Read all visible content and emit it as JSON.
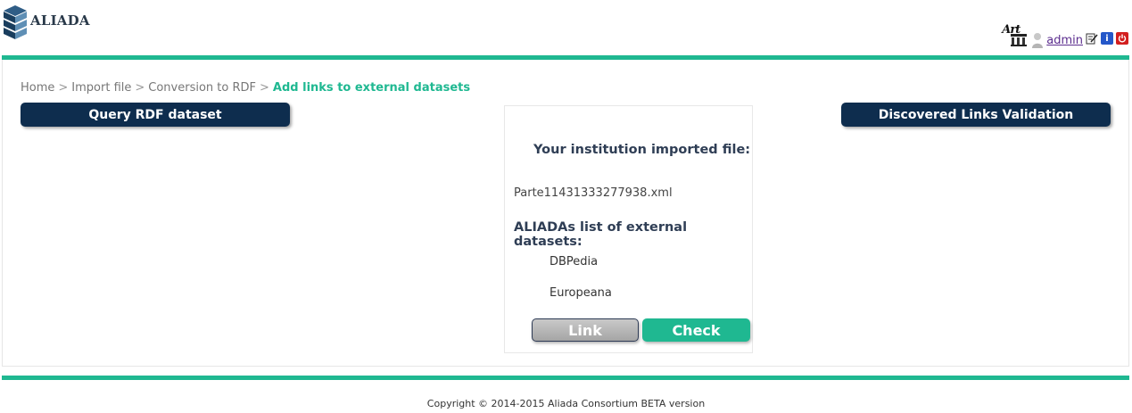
{
  "header": {
    "logo_text": "ALIADA",
    "art_icon_text": "Art",
    "username": "admin",
    "icons": [
      "art-museum-icon",
      "user-icon",
      "edit-icon",
      "info-icon",
      "power-icon"
    ]
  },
  "breadcrumb": {
    "items": [
      "Home",
      "Import file",
      "Conversion to RDF"
    ],
    "current": "Add links to external datasets"
  },
  "nav": {
    "query_label": "Query RDF dataset",
    "discovered_label": "Discovered Links Validation"
  },
  "panel": {
    "title": "Your institution imported file:",
    "filename": "Parte11431333277938.xml",
    "datasets_title": "ALIADAs list of external datasets:",
    "datasets": [
      "DBPedia",
      "Europeana"
    ],
    "link_label": "Link",
    "check_label": "Check"
  },
  "footer": {
    "text": "Copyright © 2014-2015 Aliada Consortium BETA version"
  },
  "colors": {
    "accent": "#1fb891",
    "navy": "#0e2d4e",
    "link_purple": "#5b2d8e"
  }
}
